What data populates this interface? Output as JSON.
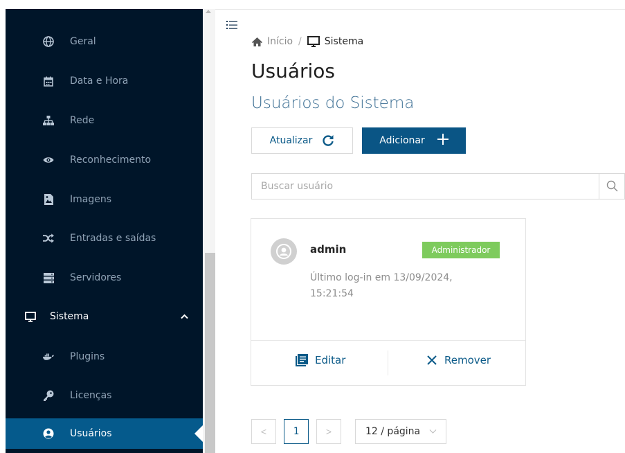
{
  "sidebar": {
    "items": [
      {
        "label": "Geral",
        "icon": "globe-icon"
      },
      {
        "label": "Data e Hora",
        "icon": "calendar-icon"
      },
      {
        "label": "Rede",
        "icon": "network-icon"
      },
      {
        "label": "Reconhecimento",
        "icon": "eye-icon"
      },
      {
        "label": "Imagens",
        "icon": "image-file-icon"
      },
      {
        "label": "Entradas e saídas",
        "icon": "shuffle-icon"
      },
      {
        "label": "Servidores",
        "icon": "server-icon"
      }
    ],
    "group": {
      "label": "Sistema",
      "icon": "monitor-icon",
      "expanded": true
    },
    "sub_items": [
      {
        "label": "Plugins",
        "icon": "docker-icon"
      },
      {
        "label": "Licenças",
        "icon": "key-icon"
      },
      {
        "label": "Usuários",
        "icon": "user-circle-icon",
        "active": true
      }
    ]
  },
  "breadcrumb": {
    "home": "Início",
    "separator": "/",
    "current": "Sistema"
  },
  "page": {
    "title": "Usuários",
    "subtitle": "Usuários do Sistema"
  },
  "toolbar": {
    "refresh_label": "Atualizar",
    "add_label": "Adicionar"
  },
  "search": {
    "placeholder": "Buscar usuário",
    "value": ""
  },
  "users": [
    {
      "username": "admin",
      "role": "Administrador",
      "last_login": "Último log-in em 13/09/2024, 15:21:54",
      "edit_label": "Editar",
      "remove_label": "Remover"
    }
  ],
  "pagination": {
    "prev": "<",
    "current_page": "1",
    "next": ">",
    "page_size": "12 / página"
  },
  "colors": {
    "sidebar_bg": "#001529",
    "active_bg": "#055a8c",
    "primary": "#0a5585",
    "role_badge": "#7ecb5d"
  }
}
